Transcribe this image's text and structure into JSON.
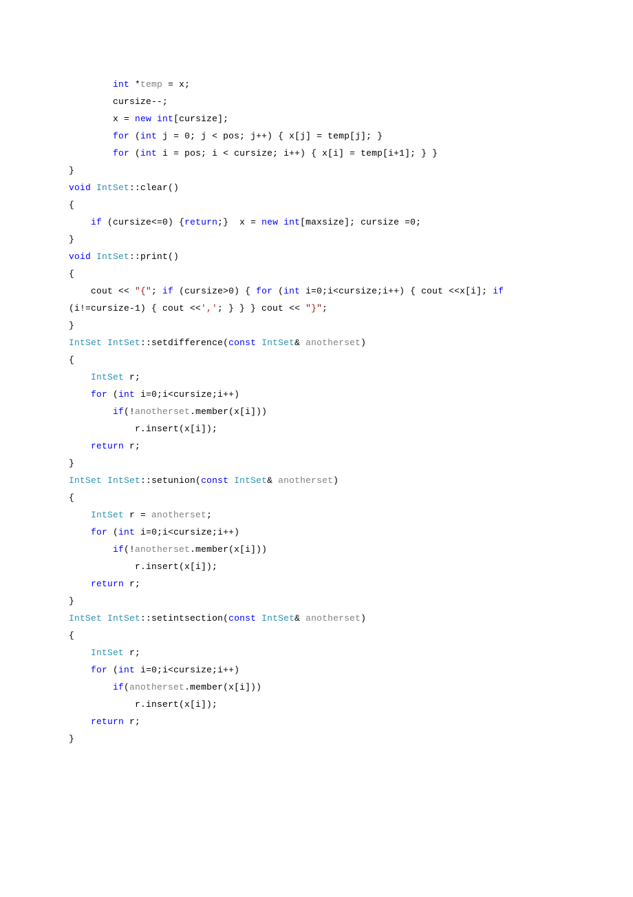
{
  "code": {
    "line1_a": "        ",
    "line1_b": "int",
    "line1_c": " *",
    "line1_d": "temp",
    "line1_e": " = x;",
    "line2": "        cursize--;",
    "line3_a": "        x = ",
    "line3_b": "new",
    "line3_c": " ",
    "line3_d": "int",
    "line3_e": "[cursize];",
    "line4_a": "        ",
    "line4_b": "for",
    "line4_c": " (",
    "line4_d": "int",
    "line4_e": " j = 0; j < pos; j++) { x[j] = temp[j]; }",
    "line5_a": "        ",
    "line5_b": "for",
    "line5_c": " (",
    "line5_d": "int",
    "line5_e": " i = pos; i < cursize; i++) { x[i] = temp[i+1]; } }",
    "line6": "}",
    "line7_a": "void",
    "line7_b": " ",
    "line7_c": "IntSet",
    "line7_d": "::clear()",
    "line8": "{",
    "line9_a": "    ",
    "line9_b": "if",
    "line9_c": " (cursize<=0) {",
    "line9_d": "return",
    "line9_e": ";}  x = ",
    "line9_f": "new",
    "line9_g": " ",
    "line9_h": "int",
    "line9_i": "[maxsize]; cursize =0;",
    "line10": "}",
    "line11_a": "void",
    "line11_b": " ",
    "line11_c": "IntSet",
    "line11_d": "::print()",
    "line12": "{",
    "line13_a": "    cout << ",
    "line13_b": "\"{\"",
    "line13_c": "; ",
    "line13_d": "if",
    "line13_e": " (cursize>0) { ",
    "line13_f": "for",
    "line13_g": " (",
    "line13_h": "int",
    "line13_i": " i=0;i<cursize;i++) { cout <<x[i]; ",
    "line13_j": "if",
    "line14_a": "(i!=cursize-1) { cout <<",
    "line14_b": "','",
    "line14_c": "; } } } cout << ",
    "line14_d": "\"}\"",
    "line14_e": ";",
    "line15": "}",
    "line16_a": "IntSet",
    "line16_b": " ",
    "line16_c": "IntSet",
    "line16_d": "::setdifference(",
    "line16_e": "const",
    "line16_f": " ",
    "line16_g": "IntSet",
    "line16_h": "& ",
    "line16_i": "anotherset",
    "line16_j": ")",
    "line17": "{",
    "line18_a": "    ",
    "line18_b": "IntSet",
    "line18_c": " r;",
    "line19_a": "    ",
    "line19_b": "for",
    "line19_c": " (",
    "line19_d": "int",
    "line19_e": " i=0;i<cursize;i++)",
    "line20_a": "        ",
    "line20_b": "if",
    "line20_c": "(!",
    "line20_d": "anotherset",
    "line20_e": ".member(x[i]))",
    "line21": "            r.insert(x[i]);",
    "line22_a": "    ",
    "line22_b": "return",
    "line22_c": " r;",
    "line23": "}",
    "line24_a": "IntSet",
    "line24_b": " ",
    "line24_c": "IntSet",
    "line24_d": "::setunion(",
    "line24_e": "const",
    "line24_f": " ",
    "line24_g": "IntSet",
    "line24_h": "& ",
    "line24_i": "anotherset",
    "line24_j": ")",
    "line25": "{",
    "line26_a": "    ",
    "line26_b": "IntSet",
    "line26_c": " r = ",
    "line26_d": "anotherset",
    "line26_e": ";",
    "line27_a": "    ",
    "line27_b": "for",
    "line27_c": " (",
    "line27_d": "int",
    "line27_e": " i=0;i<cursize;i++)",
    "line28_a": "        ",
    "line28_b": "if",
    "line28_c": "(!",
    "line28_d": "anotherset",
    "line28_e": ".member(x[i]))",
    "line29": "            r.insert(x[i]);",
    "line30_a": "    ",
    "line30_b": "return",
    "line30_c": " r;",
    "line31": "}",
    "line32_a": "IntSet",
    "line32_b": " ",
    "line32_c": "IntSet",
    "line32_d": "::setintsection(",
    "line32_e": "const",
    "line32_f": " ",
    "line32_g": "IntSet",
    "line32_h": "& ",
    "line32_i": "anotherset",
    "line32_j": ")",
    "line33": "{",
    "line34_a": "    ",
    "line34_b": "IntSet",
    "line34_c": " r;",
    "line35_a": "    ",
    "line35_b": "for",
    "line35_c": " (",
    "line35_d": "int",
    "line35_e": " i=0;i<cursize;i++)",
    "line36_a": "        ",
    "line36_b": "if",
    "line36_c": "(",
    "line36_d": "anotherset",
    "line36_e": ".member(x[i]))",
    "line37": "            r.insert(x[i]);",
    "line38_a": "    ",
    "line38_b": "return",
    "line38_c": " r;",
    "line39": "}"
  }
}
